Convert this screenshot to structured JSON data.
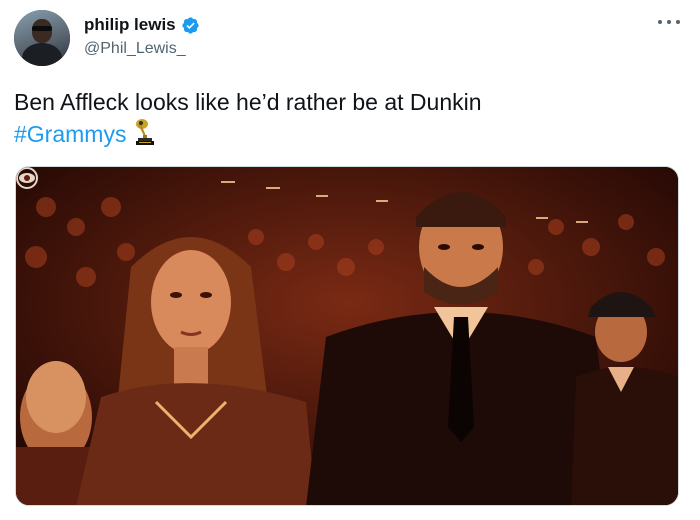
{
  "author": {
    "display_name": "philip lewis",
    "handle": "@Phil_Lewis_",
    "verified": true,
    "avatar_icon": "avatar-photo"
  },
  "tweet": {
    "text_main": "Ben Affleck looks like he’d rather be at Dunkin",
    "hashtag": "#Grammys",
    "emoji_icon": "grammy-trophy-icon"
  },
  "media": {
    "type": "video-still",
    "watermark_icon": "cbs-eye-icon"
  },
  "colors": {
    "link": "#1d9bf0",
    "text": "#0f1419",
    "secondary": "#536471",
    "verified": "#1d9bf0"
  }
}
